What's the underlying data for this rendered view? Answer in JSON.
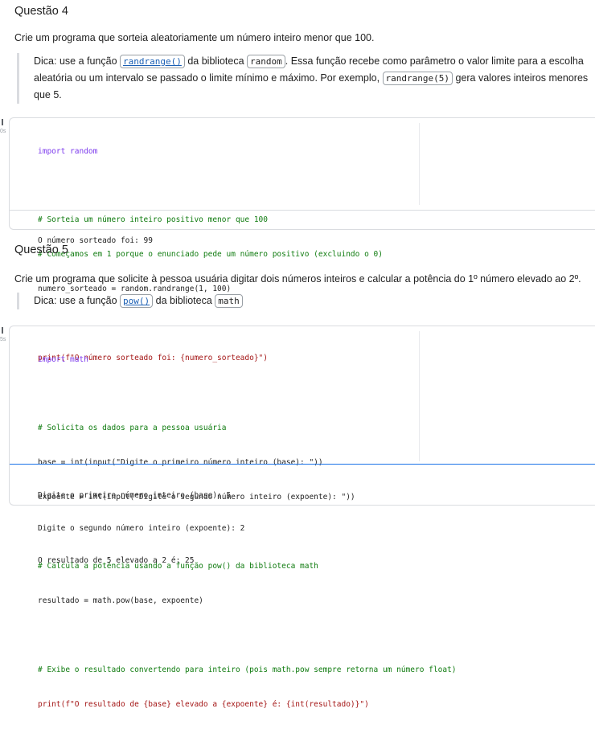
{
  "q4": {
    "title": "Questão 4",
    "prompt": "Crie um programa que sorteia aleatoriamente um número inteiro menor que 100.",
    "tip": {
      "prefix": "Dica: use a função ",
      "func": "randrange()",
      "mid1": " da biblioteca ",
      "lib": "random",
      "mid2": ". Essa função recebe como parâmetro o valor limite para a escolha aleatória ou um intervalo se passado o limite mínimo e máximo. Por exemplo, ",
      "example": "randrange(5)",
      "suffix": " gera valores inteiros menores que 5."
    },
    "cell": {
      "exec_time": "0s",
      "lines": [
        "import random",
        "",
        "# Sorteia um número inteiro positivo menor que 100",
        "# Começamos em 1 porque o enunciado pede um número positivo (excluindo o 0)",
        "numero_sorteado = random.randrange(1, 100)",
        "",
        "print(f\"O número sorteado foi: {numero_sorteado}\")"
      ],
      "output": [
        "O número sorteado foi: 99"
      ]
    }
  },
  "q5": {
    "title": "Questão 5",
    "prompt": "Crie um programa que solicite à pessoa usuária digitar dois números inteiros e calcular a potência do 1º número elevado ao 2º.",
    "tip": {
      "prefix": "Dica: use a função ",
      "func": "pow()",
      "mid1": " da biblioteca ",
      "lib": "math"
    },
    "cell": {
      "exec_time": "5s",
      "lines": [
        "import math",
        "",
        "# Solicita os dados para a pessoa usuária",
        "base = int(input(\"Digite o primeiro número inteiro (base): \"))",
        "expoente = int(input(\"Digite o segundo número inteiro (expoente): \"))",
        "",
        "# Calcula a potência usando a função pow() da biblioteca math",
        "resultado = math.pow(base, expoente)",
        "",
        "# Exibe o resultado convertendo para inteiro (pois math.pow sempre retorna um número float)",
        "print(f\"O resultado de {base} elevado a {expoente} é: {int(resultado)}\")"
      ],
      "output": [
        "Digite o primeiro número inteiro (base): 5",
        "Digite o segundo número inteiro (expoente): 2",
        "O resultado de 5 elevado a 2 é: 25"
      ]
    }
  }
}
